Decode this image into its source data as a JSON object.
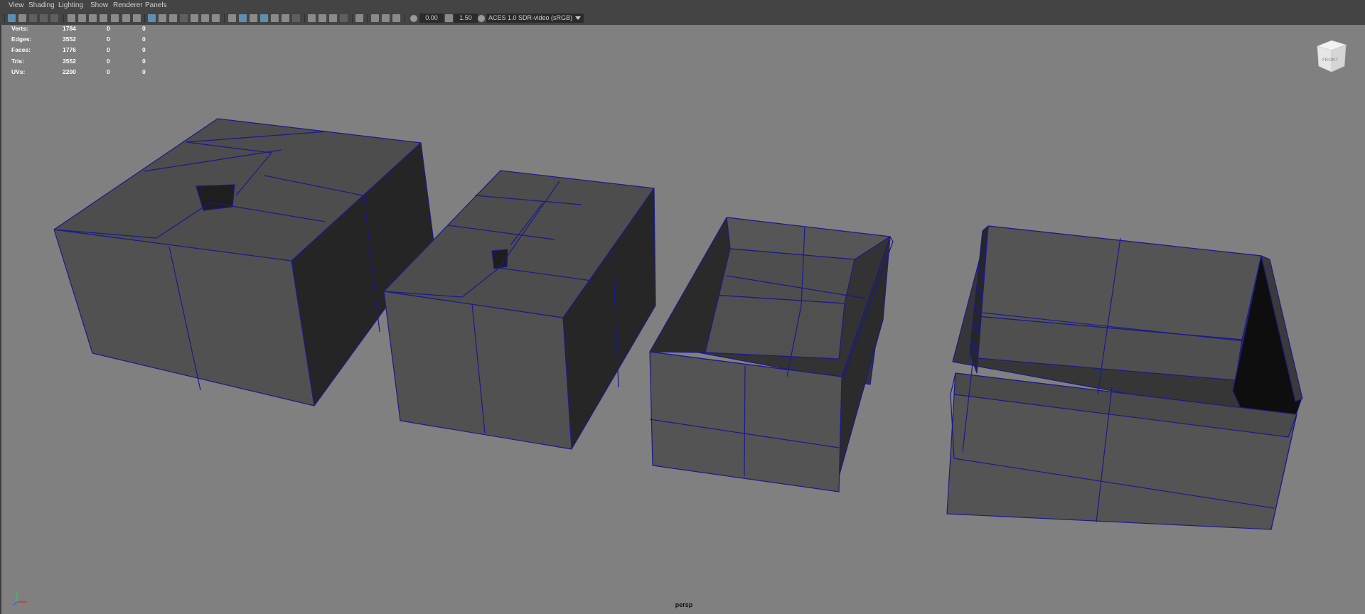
{
  "menu": [
    "View",
    "Shading",
    "Lighting",
    "Show",
    "Renderer",
    "Panels"
  ],
  "toolbar": {
    "exposure": "0.00",
    "gamma": "1.50",
    "color_management": "ACES 1.0 SDR-video (sRGB)"
  },
  "hud": {
    "rows": [
      {
        "label": "Verts:",
        "a": "1784",
        "b": "0",
        "c": "0"
      },
      {
        "label": "Edges:",
        "a": "3552",
        "b": "0",
        "c": "0"
      },
      {
        "label": "Faces:",
        "a": "1776",
        "b": "0",
        "c": "0"
      },
      {
        "label": "Tris:",
        "a": "3552",
        "b": "0",
        "c": "0"
      },
      {
        "label": "UVs:",
        "a": "2200",
        "b": "0",
        "c": "0"
      }
    ]
  },
  "viewcube": {
    "label": "FRONT"
  },
  "camera": {
    "label": "persp"
  },
  "colors": {
    "wire": "#1a1a8c",
    "viewport_bg": "#808080",
    "face": "#4f4f4f",
    "face_dark": "#262626"
  }
}
